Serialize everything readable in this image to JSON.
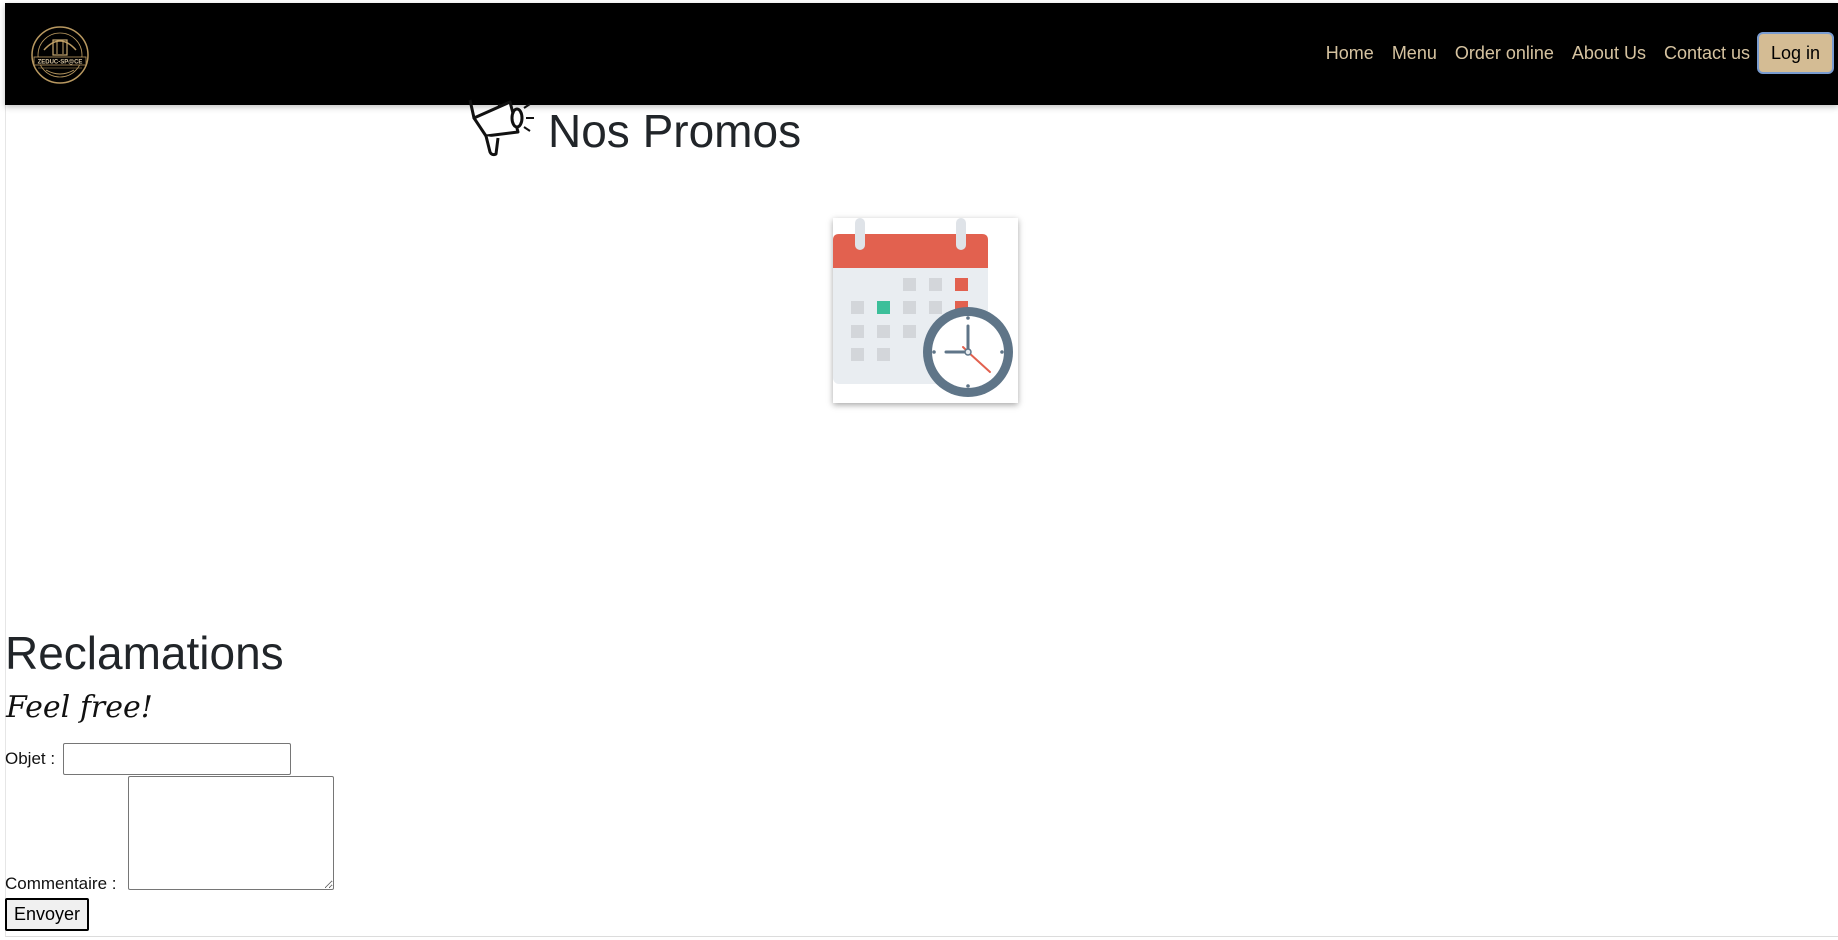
{
  "header": {
    "logo_text": "ZEDUC-SP@CE",
    "nav": [
      "Home",
      "Menu",
      "Order online",
      "About Us",
      "Contact us"
    ],
    "login_label": "Log in"
  },
  "promos": {
    "title": "Nos Promos",
    "icon": "megaphone-icon",
    "image": "calendar-clock-icon"
  },
  "reclamations": {
    "title": "Reclamations",
    "subtitle": "Feel free!",
    "objet_label": "Objet :",
    "objet_value": "",
    "commentaire_label": "Commentaire :",
    "commentaire_value": "",
    "submit_label": "Envoyer"
  },
  "colors": {
    "navbar_bg": "#000000",
    "nav_link": "#d6c3a0",
    "login_bg": "#d4bc94"
  }
}
